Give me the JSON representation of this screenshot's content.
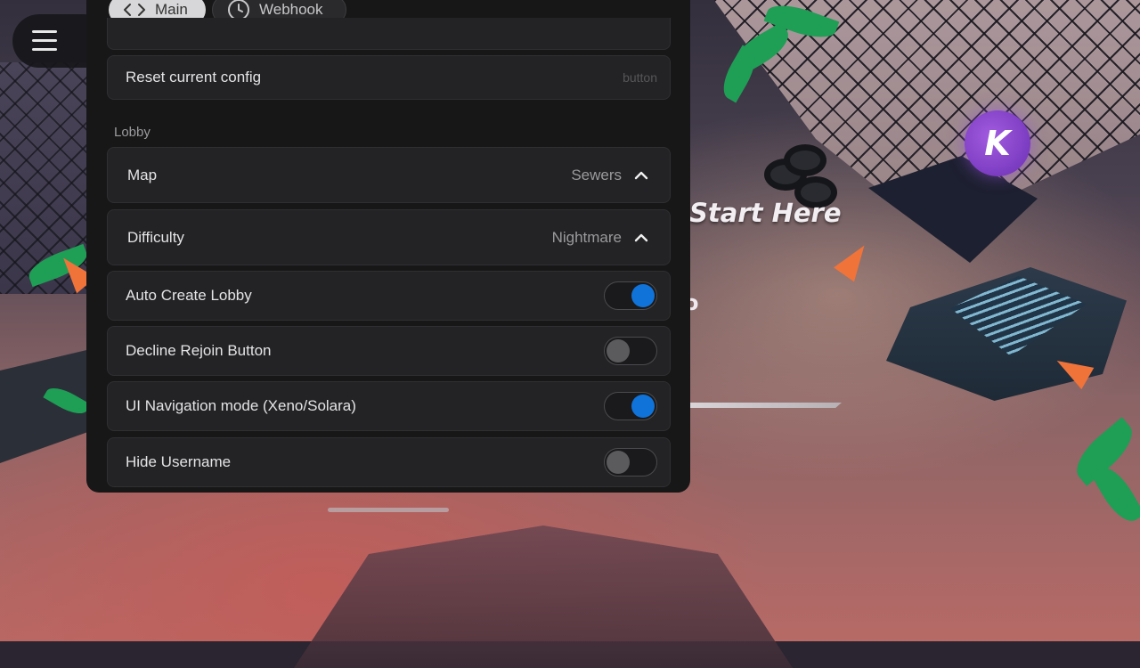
{
  "tabs": [
    {
      "label": "Main",
      "icon": "code-icon",
      "active": true
    },
    {
      "label": "Webhook",
      "icon": "clock-icon",
      "active": false
    }
  ],
  "config": {
    "reset_label": "Reset current config",
    "reset_hint": "button"
  },
  "lobby": {
    "section_title": "Lobby",
    "map": {
      "label": "Map",
      "value": "Sewers"
    },
    "difficulty": {
      "label": "Difficulty",
      "value": "Nightmare"
    },
    "toggles": [
      {
        "label": "Auto Create Lobby",
        "on": true
      },
      {
        "label": "Decline Rejoin Button",
        "on": false
      },
      {
        "label": "UI Navigation mode (Xeno/Solara)",
        "on": true
      },
      {
        "label": "Hide Username",
        "on": false
      }
    ]
  },
  "game": {
    "sign_text": "Start Here",
    "fragment_text": "o",
    "badge_letter": "K"
  },
  "colors": {
    "toggle_on": "#0f73d9",
    "toggle_off": "#5b5b5e",
    "panel_bg": "#171718",
    "badge": "#8a45d0"
  }
}
